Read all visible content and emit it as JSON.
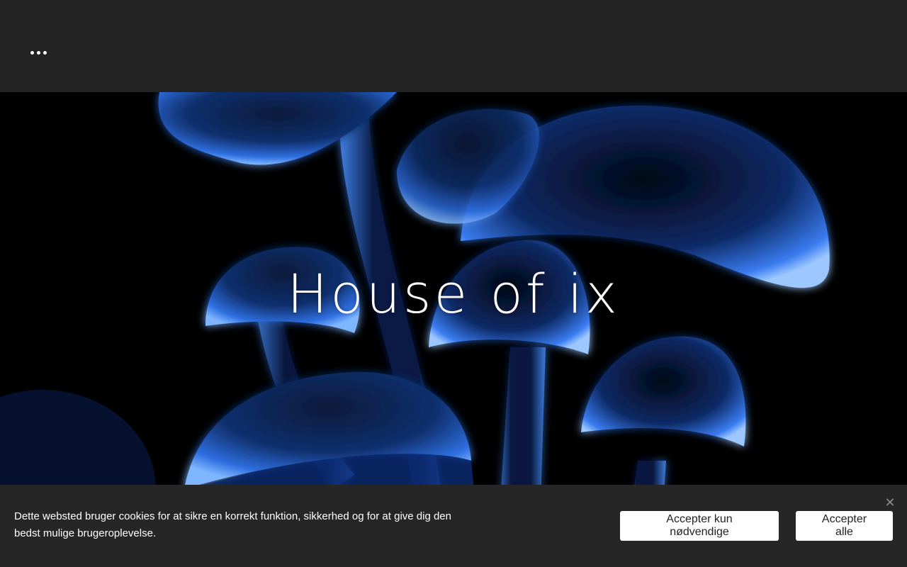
{
  "header": {
    "menu_icon": "more-dots-icon"
  },
  "hero": {
    "title": "House of ix",
    "background": "glowing-blue-mushrooms-image"
  },
  "cookie_banner": {
    "message": "Dette websted bruger cookies for at sikre en korrekt funktion, sikkerhed og for at give dig den bedst mulige brugeroplevelse.",
    "accept_necessary_label": "Accepter kun nødvendige",
    "accept_all_label": "Accepter alle",
    "close_icon": "close-icon"
  },
  "colors": {
    "header_bg": "#232323",
    "cookie_bg": "#262626",
    "glow_blue": "#3d8bff"
  }
}
